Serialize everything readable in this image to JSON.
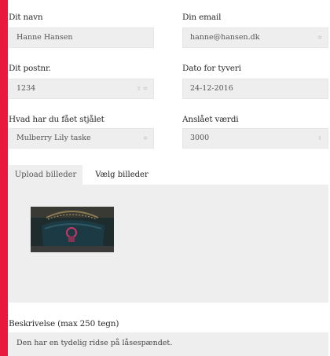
{
  "form": {
    "name": {
      "label": "Dit navn",
      "value": "Hanne Hansen"
    },
    "email": {
      "label": "Din email",
      "value": "hanne@hansen.dk"
    },
    "postal": {
      "label": "Dit postnr.",
      "value": "1234"
    },
    "theft_date": {
      "label": "Dato for tyveri",
      "value": "24-12-2016"
    },
    "stolen_item": {
      "label": "Hvad har du fået stjålet",
      "value": "Mulberry Lily taske"
    },
    "value_estimate": {
      "label": "Anslået værdi",
      "value": "3000"
    },
    "description": {
      "label": "Beskrivelse (max 250 tegn)",
      "value": "Den har en tydelig ridse på låsespændet."
    }
  },
  "upload": {
    "tabs": [
      {
        "label": "Upload billeder",
        "active": false
      },
      {
        "label": "Vælg billeder",
        "active": true
      }
    ]
  },
  "colors": {
    "background": "#e8193c",
    "field": "#eeeeee"
  }
}
